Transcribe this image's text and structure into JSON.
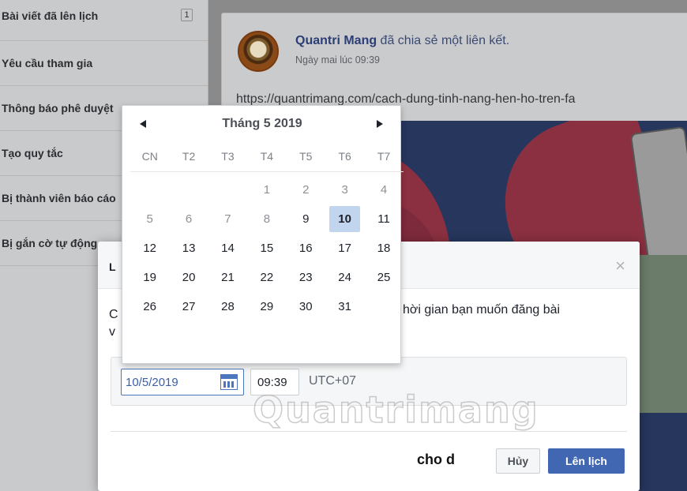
{
  "sidebar": {
    "items": [
      {
        "label": "Bài viết đã lên lịch",
        "count": "1"
      },
      {
        "label": "Yêu cầu tham gia"
      },
      {
        "label": "Thông báo phê duyệt"
      },
      {
        "label": "Tạo quy tắc"
      },
      {
        "label": "Bị thành viên báo cáo"
      },
      {
        "label": "Bị gắn cờ tự động"
      }
    ]
  },
  "post": {
    "author": "Quantri Mang",
    "action": " đã chia sẻ một liên kết.",
    "time": "Ngày mai lúc 09:39",
    "link": "https://quantrimang.com/cach-dung-tinh-nang-hen-ho-tren-fa",
    "bottom_text": "cho d"
  },
  "dialog": {
    "title": "L",
    "close_icon": "close-icon",
    "text_prefix": "C",
    "text_prefix2": "v",
    "text_visible": "hời gian bạn muốn đăng bài",
    "date_value": "10/5/2019",
    "time_value": "09:39",
    "timezone": "UTC+07",
    "cancel_label": "Hủy",
    "schedule_label": "Lên lịch"
  },
  "calendar": {
    "title": "Tháng 5 2019",
    "weekdays": [
      "CN",
      "T2",
      "T3",
      "T4",
      "T5",
      "T6",
      "T7"
    ],
    "weeks": [
      [
        "",
        "",
        "",
        "1",
        "2",
        "3",
        "4"
      ],
      [
        "5",
        "6",
        "7",
        "8",
        "9",
        "10",
        "11"
      ],
      [
        "12",
        "13",
        "14",
        "15",
        "16",
        "17",
        "18"
      ],
      [
        "19",
        "20",
        "21",
        "22",
        "23",
        "24",
        "25"
      ],
      [
        "26",
        "27",
        "28",
        "29",
        "30",
        "31",
        ""
      ]
    ],
    "muted_days": [
      "1",
      "2",
      "3",
      "4",
      "5",
      "6",
      "7",
      "8"
    ],
    "selected_day": "10"
  },
  "watermark": "Quantrimang",
  "colors": {
    "accent": "#4267b2",
    "selected_day": "#c2d5ee",
    "link": "#3b5ea8"
  }
}
